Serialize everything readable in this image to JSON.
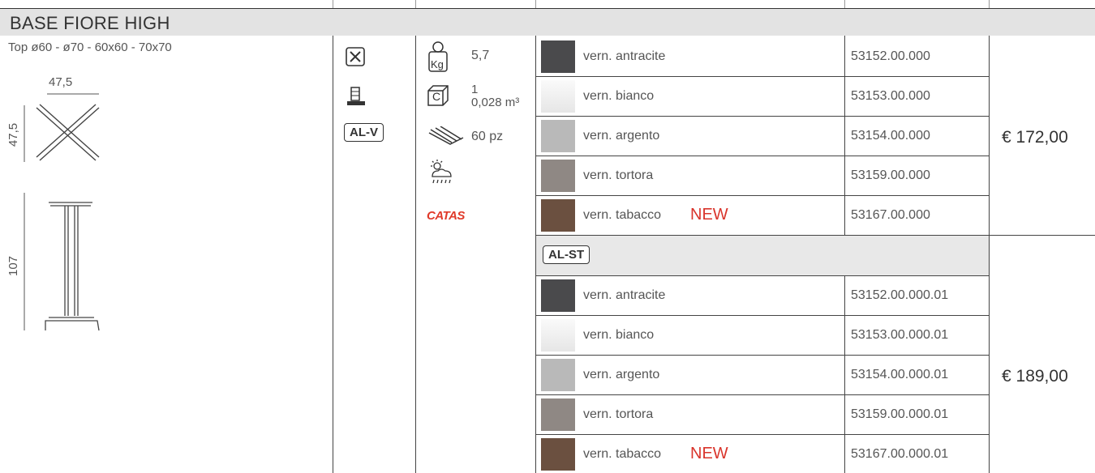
{
  "header": {
    "title": "BASE FIORE HIGH"
  },
  "drawing": {
    "tops": "Top  ø60 - ø70 - 60x60 - 70x70",
    "dim_width": "47,5",
    "dim_depth": "47,5",
    "dim_height": "107"
  },
  "symbols": {
    "badge_alv": "AL-V",
    "badge_alst": "AL-ST",
    "weight": "5,7",
    "weight_unit": "Kg",
    "pack_qty": "1",
    "pack_volume": "0,028 m³",
    "pallet": "60 pz",
    "catas": "CATAS",
    "box_letter": "C"
  },
  "rows": [
    {
      "finish": "vern. antracite",
      "code": "53152.00.000",
      "color": "#4a4a4c"
    },
    {
      "finish": "vern. bianco",
      "code": "53153.00.000",
      "color": "#f4f4f4"
    },
    {
      "finish": "vern. argento",
      "code": "53154.00.000",
      "color": "#b9b9b9"
    },
    {
      "finish": "vern. tortora",
      "code": "53159.00.000",
      "color": "#8f8884"
    },
    {
      "finish": "vern. tabacco",
      "code": "53167.00.000",
      "color": "#6b5040",
      "new": "NEW"
    }
  ],
  "rows2": [
    {
      "finish": "vern. antracite",
      "code": "53152.00.000.01",
      "color": "#4a4a4c"
    },
    {
      "finish": "vern. bianco",
      "code": "53153.00.000.01",
      "color": "#f4f4f4"
    },
    {
      "finish": "vern. argento",
      "code": "53154.00.000.01",
      "color": "#b9b9b9"
    },
    {
      "finish": "vern. tortora",
      "code": "53159.00.000.01",
      "color": "#8f8884"
    },
    {
      "finish": "vern. tabacco",
      "code": "53167.00.000.01",
      "color": "#6b5040",
      "new": "NEW"
    }
  ],
  "prices": {
    "alv": "€ 172,00",
    "alst": "€ 189,00"
  }
}
